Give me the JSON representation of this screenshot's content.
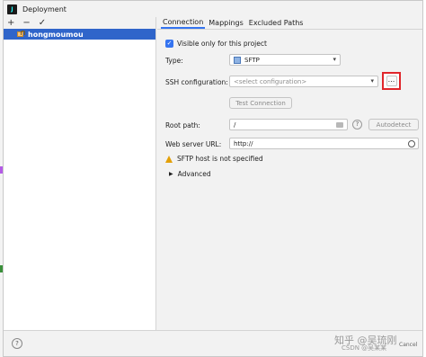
{
  "window": {
    "title": "Deployment",
    "app_icon_glyph": "J"
  },
  "toolbar": {
    "add": "+",
    "remove": "−",
    "apply": "✓"
  },
  "servers": [
    {
      "label": "hongmoumou",
      "selected": true
    }
  ],
  "tabs": [
    {
      "label": "Connection",
      "active": true
    },
    {
      "label": "Mappings",
      "active": false
    },
    {
      "label": "Excluded Paths",
      "active": false
    }
  ],
  "form": {
    "visible_only_label": "Visible only for this project",
    "visible_only_checked": true,
    "type_label": "Type:",
    "type_value": "SFTP",
    "ssh_label": "SSH configuration:",
    "ssh_placeholder": "<select configuration>",
    "ellipsis": "...",
    "test_connection": "Test Connection",
    "root_path_label": "Root path:",
    "root_path_value": "/",
    "autodetect": "Autodetect",
    "web_url_label": "Web server URL:",
    "web_url_value": "http://",
    "warning": "SFTP host is not specified",
    "advanced": "Advanced"
  },
  "bottom": {
    "help": "?",
    "watermark_main": "知乎 @吴琉刚",
    "watermark_sub": "CSDN @吴某某",
    "cancel_fragment": "Cancel"
  },
  "colors": {
    "accent": "#3574f0",
    "selection": "#2f65ca",
    "highlight_box": "#e0262b",
    "warning": "#e3a008"
  }
}
